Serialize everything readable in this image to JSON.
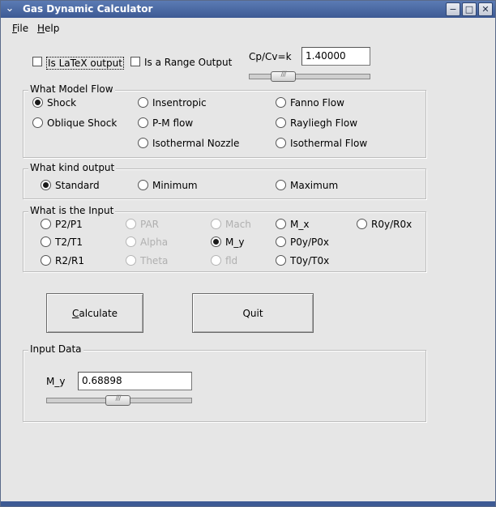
{
  "window": {
    "title": "Gas Dynamic Calculator",
    "controls": {
      "minimize": "−",
      "maximize": "□",
      "close": "✕"
    }
  },
  "menubar": {
    "file": {
      "mnemonic": "F",
      "rest": "ile"
    },
    "help": {
      "mnemonic": "H",
      "rest": "elp"
    }
  },
  "options": {
    "latex_output_label": "Is LaTeX output",
    "latex_output_checked": false,
    "range_output_label": "Is a Range Output",
    "range_output_checked": false,
    "k_label": "Cp/Cv=k",
    "k_value": "1.40000",
    "k_slider_level": 0.22
  },
  "model_flow": {
    "title": "What Model Flow",
    "options": {
      "shock": "Shock",
      "insentropic": "Insentropic",
      "fanno": "Fanno Flow",
      "oblique": "Oblique Shock",
      "pm": "P-M flow",
      "rayleigh": "Rayliegh Flow",
      "isothermal_nozzle": "Isothermal Nozzle",
      "isothermal_flow": "Isothermal Flow"
    },
    "selected": "shock"
  },
  "output_kind": {
    "title": "What kind output",
    "options": {
      "standard": "Standard",
      "minimum": "Minimum",
      "maximum": "Maximum"
    },
    "selected": "standard"
  },
  "input": {
    "title": "What is the Input",
    "options": {
      "p2p1": "P2/P1",
      "par": "PAR",
      "mach": "Mach",
      "mx": "M_x",
      "r0y": "R0y/R0x",
      "t2t1": "T2/T1",
      "alpha": "Alpha",
      "my": "M_y",
      "p0y": "P0y/P0x",
      "r2r1": "R2/R1",
      "theta": "Theta",
      "fld": "fld",
      "t0y": "T0y/T0x"
    },
    "disabled": [
      "par",
      "mach",
      "alpha",
      "theta",
      "fld"
    ],
    "selected": "my"
  },
  "buttons": {
    "calculate": {
      "mnemonic": "C",
      "rest": "alculate"
    },
    "quit": "Quit"
  },
  "input_data": {
    "title": "Input Data",
    "field_label": "M_y",
    "field_value": "0.68898",
    "slider_level": 0.49
  },
  "colors": {
    "titlebar": "#4a6aa4",
    "window_bg": "#e6e6e6"
  }
}
